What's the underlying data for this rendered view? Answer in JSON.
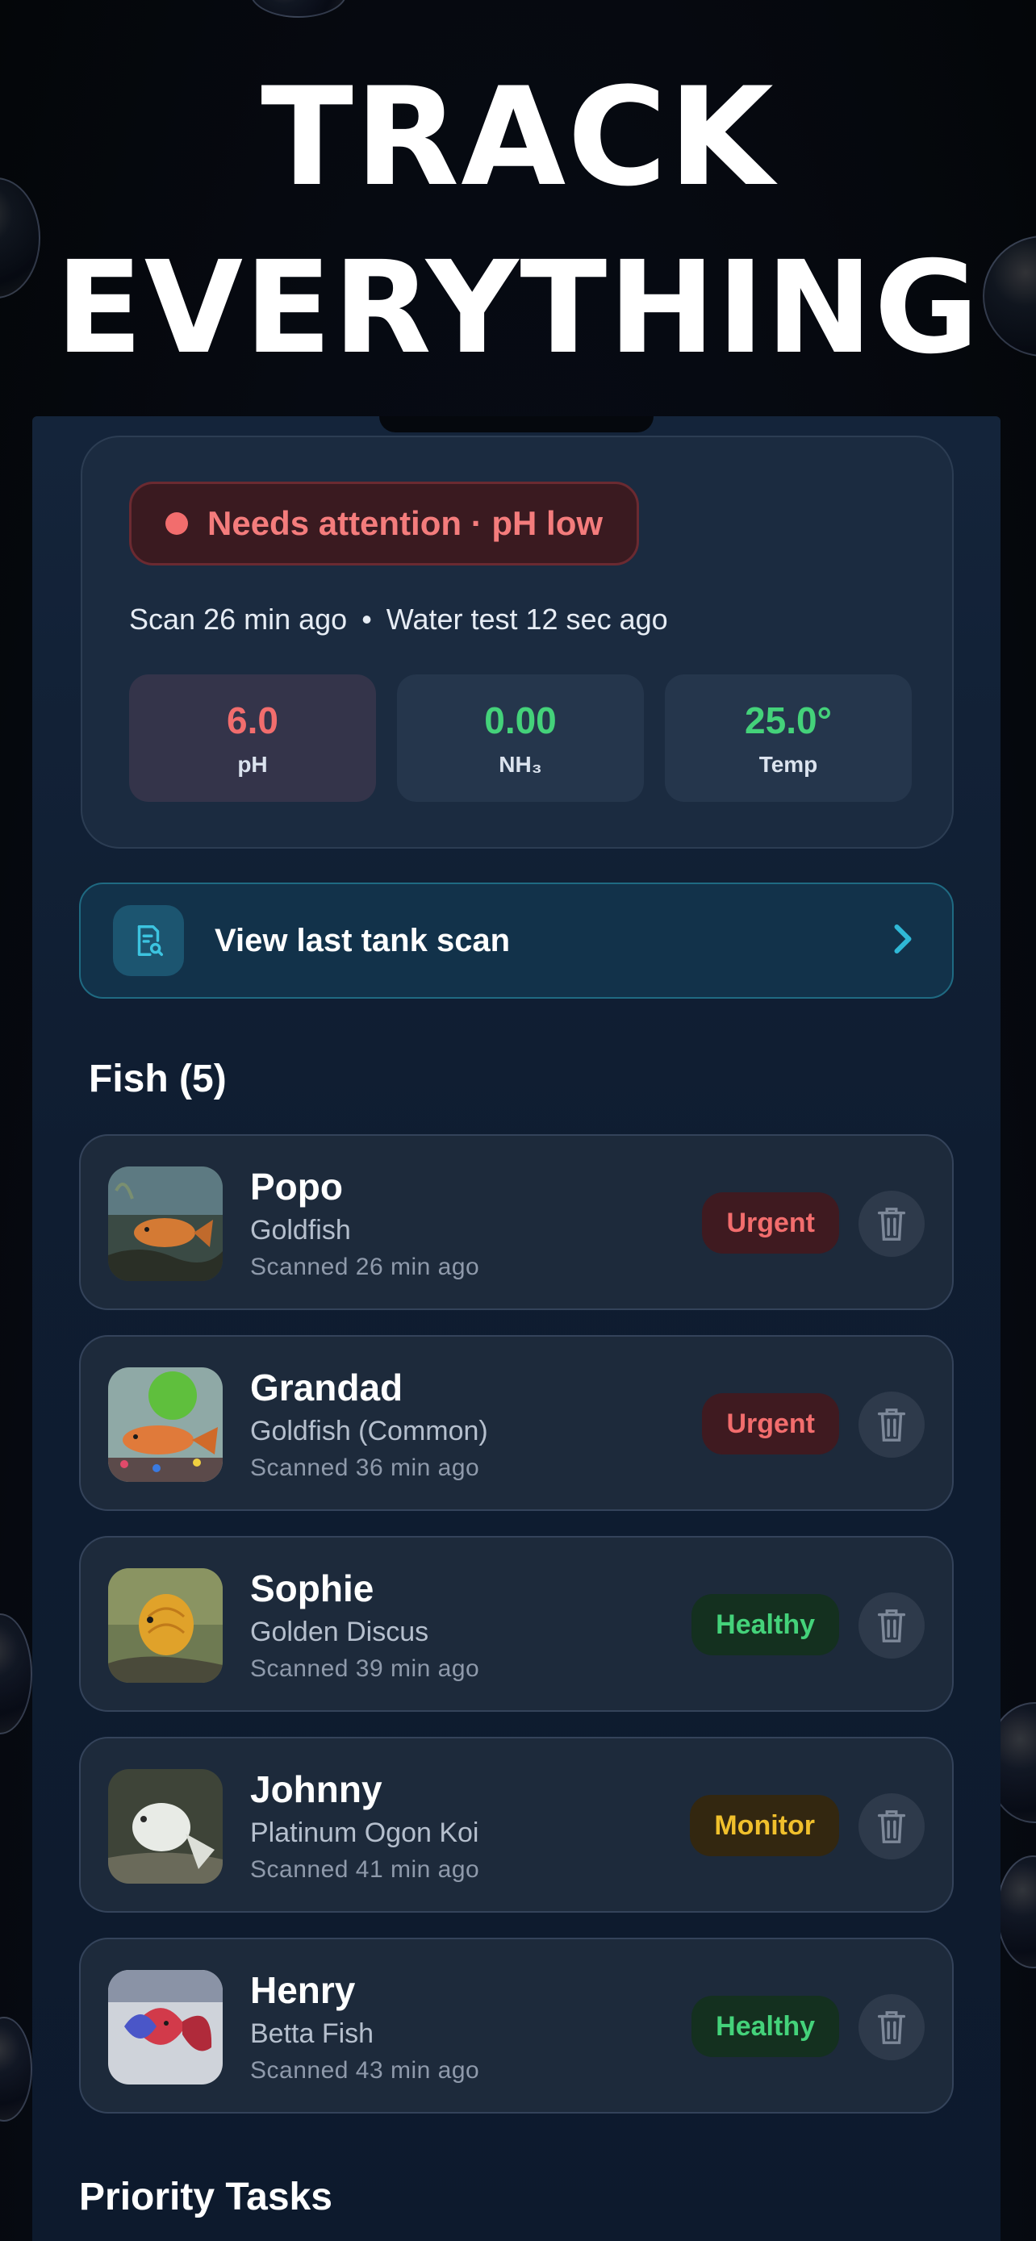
{
  "headline": {
    "line1": "TRACK",
    "line2": "EVERYTHING"
  },
  "status": {
    "alert": "Needs attention · pH low",
    "scan_time": "Scan 26 min ago",
    "separator": "•",
    "water_test_time": "Water test 12 sec ago",
    "metrics": [
      {
        "value": "6.0",
        "label": "pH",
        "color": "#f26d6d"
      },
      {
        "value": "0.00",
        "label": "NH₃",
        "color": "#44d27a"
      },
      {
        "value": "25.0°",
        "label": "Temp",
        "color": "#44d27a"
      }
    ]
  },
  "scan_button": {
    "label": "View last tank scan",
    "icon": "document-search-icon"
  },
  "fish_section": {
    "title": "Fish (5)",
    "items": [
      {
        "name": "Popo",
        "species": "Goldfish",
        "scanned": "Scanned 26 min ago",
        "status": "Urgent"
      },
      {
        "name": "Grandad",
        "species": "Goldfish (Common)",
        "scanned": "Scanned 36 min ago",
        "status": "Urgent"
      },
      {
        "name": "Sophie",
        "species": "Golden Discus",
        "scanned": "Scanned 39 min ago",
        "status": "Healthy"
      },
      {
        "name": "Johnny",
        "species": "Platinum Ogon Koi",
        "scanned": "Scanned 41 min ago",
        "status": "Monitor"
      },
      {
        "name": "Henry",
        "species": "Betta Fish",
        "scanned": "Scanned 43 min ago",
        "status": "Healthy"
      }
    ]
  },
  "priority_tasks": {
    "title": "Priority Tasks"
  },
  "colors": {
    "urgent": "#f26d6d",
    "healthy": "#44d27a",
    "monitor": "#f0c02c",
    "accent": "#2fb8d6"
  }
}
